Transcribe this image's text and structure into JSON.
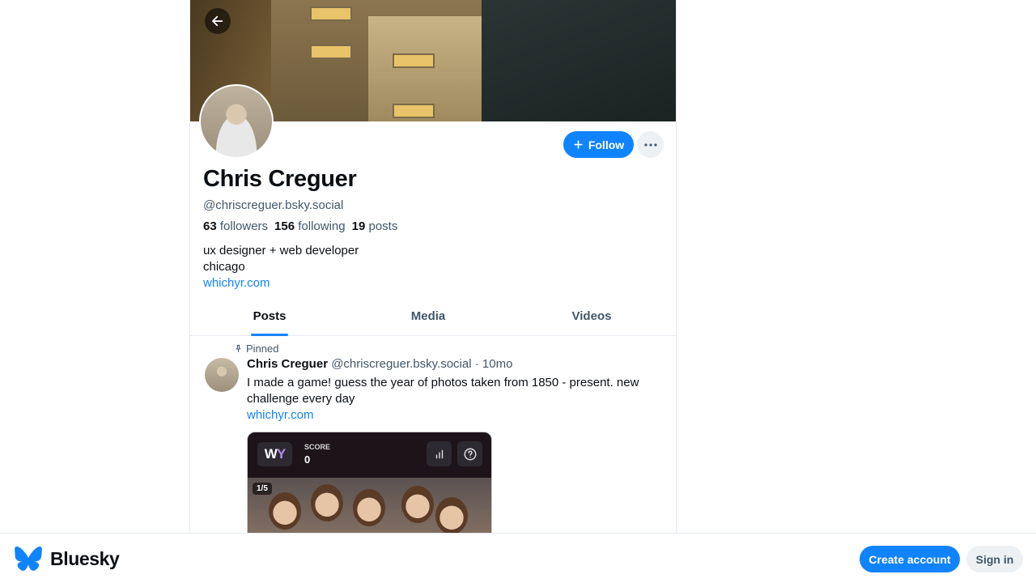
{
  "profile": {
    "name": "Chris Creguer",
    "handle": "@chriscreguer.bsky.social",
    "followers_count": "63",
    "followers_label": "followers",
    "following_count": "156",
    "following_label": "following",
    "posts_count": "19",
    "posts_label": "posts",
    "bio_line1": "ux designer + web developer",
    "bio_line2": "chicago",
    "bio_link": "whichyr.com",
    "follow_label": "Follow",
    "more_icon": "ellipsis-icon",
    "back_icon": "arrow-left-icon"
  },
  "tabs": [
    {
      "label": "Posts",
      "active": true
    },
    {
      "label": "Media",
      "active": false
    },
    {
      "label": "Videos",
      "active": false
    }
  ],
  "post": {
    "pinned_label": "Pinned",
    "author_name": "Chris Creguer",
    "author_handle": "@chriscreguer.bsky.social",
    "separator": "·",
    "time": "10mo",
    "text": "I made a game! guess the year of photos taken from 1850 - present. new challenge every day",
    "link": "whichyr.com",
    "embed": {
      "logo_w": "W",
      "logo_y": "Y",
      "score_label": "SCORE",
      "score_value": "0",
      "counter": "1/5",
      "icons": [
        "bar-chart-icon",
        "help-icon"
      ]
    }
  },
  "footer": {
    "brand_name": "Bluesky",
    "brand_icon": "butterfly-logo-icon",
    "create_account_label": "Create account",
    "sign_in_label": "Sign in"
  },
  "colors": {
    "accent": "#1083fe",
    "text_primary": "#0b0f14",
    "text_secondary": "#42576c",
    "border": "#e5e9ee"
  }
}
